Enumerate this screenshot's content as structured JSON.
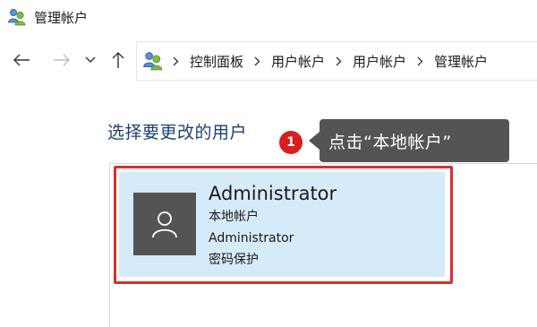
{
  "window": {
    "title": "管理帐户"
  },
  "navigation": {
    "back_icon": "arrow-left-icon",
    "forward_icon": "arrow-right-icon",
    "recent_icon": "chevron-down-icon",
    "up_icon": "arrow-up-icon"
  },
  "address_bar": {
    "location_icon": "users-icon",
    "breadcrumbs": [
      "控制面板",
      "用户帐户",
      "用户帐户",
      "管理帐户"
    ]
  },
  "main": {
    "heading": "选择要更改的用户",
    "account": {
      "name": "Administrator",
      "type": "本地帐户",
      "group": "Administrator",
      "protection": "密码保护"
    }
  },
  "annotation": {
    "step_number": "1",
    "text": "点击“本地帐户”",
    "colors": {
      "highlight": "#d93030",
      "badge": "#d81e1e",
      "tooltip_bg": "#545454"
    }
  },
  "colors": {
    "heading": "#1e3f73",
    "tile_bg": "#d6ebfa",
    "avatar_bg": "#545454"
  }
}
